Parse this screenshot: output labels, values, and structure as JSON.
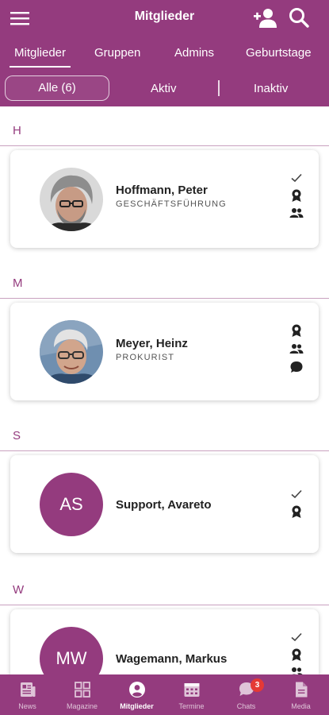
{
  "header": {
    "title": "Mitglieder",
    "icons": {
      "menu": "menu-icon",
      "add": "add-user-icon",
      "search": "search-icon"
    }
  },
  "tabs": [
    {
      "label": "Mitglieder",
      "active": true
    },
    {
      "label": "Gruppen"
    },
    {
      "label": "Admins"
    },
    {
      "label": "Geburtstage"
    }
  ],
  "filters": {
    "all": "Alle (6)",
    "active": "Aktiv",
    "inactive": "Inaktiv"
  },
  "sections": [
    {
      "letter": "H",
      "members": [
        {
          "name": "Hoffmann, Peter",
          "role": "GESCHÄFTSFÜHRUNG",
          "avatar": "photo",
          "icons": [
            "check-icon",
            "award-icon",
            "group-icon"
          ]
        }
      ]
    },
    {
      "letter": "M",
      "members": [
        {
          "name": "Meyer, Heinz",
          "role": "PROKURIST",
          "avatar": "photo",
          "icons": [
            "award-icon",
            "group-icon",
            "chat-icon"
          ]
        }
      ]
    },
    {
      "letter": "S",
      "members": [
        {
          "name": "Support, Avareto",
          "role": "",
          "initials": "AS",
          "icons": [
            "check-icon",
            "award-icon"
          ]
        }
      ]
    },
    {
      "letter": "W",
      "members": [
        {
          "name": "Wagemann, Markus",
          "role": "",
          "initials": "MW",
          "icons": [
            "check-icon",
            "award-icon",
            "group-icon"
          ]
        }
      ]
    }
  ],
  "bottom_nav": [
    {
      "label": "News",
      "icon": "news-icon"
    },
    {
      "label": "Magazine",
      "icon": "grid-icon"
    },
    {
      "label": "Mitglieder",
      "icon": "person-icon",
      "active": true
    },
    {
      "label": "Termine",
      "icon": "calendar-icon"
    },
    {
      "label": "Chats",
      "icon": "chat-icon",
      "badge": "3"
    },
    {
      "label": "Media",
      "icon": "file-icon"
    }
  ],
  "colors": {
    "primary": "#943b7e",
    "badge": "#e53935",
    "section_line": "#c9a1bf"
  }
}
